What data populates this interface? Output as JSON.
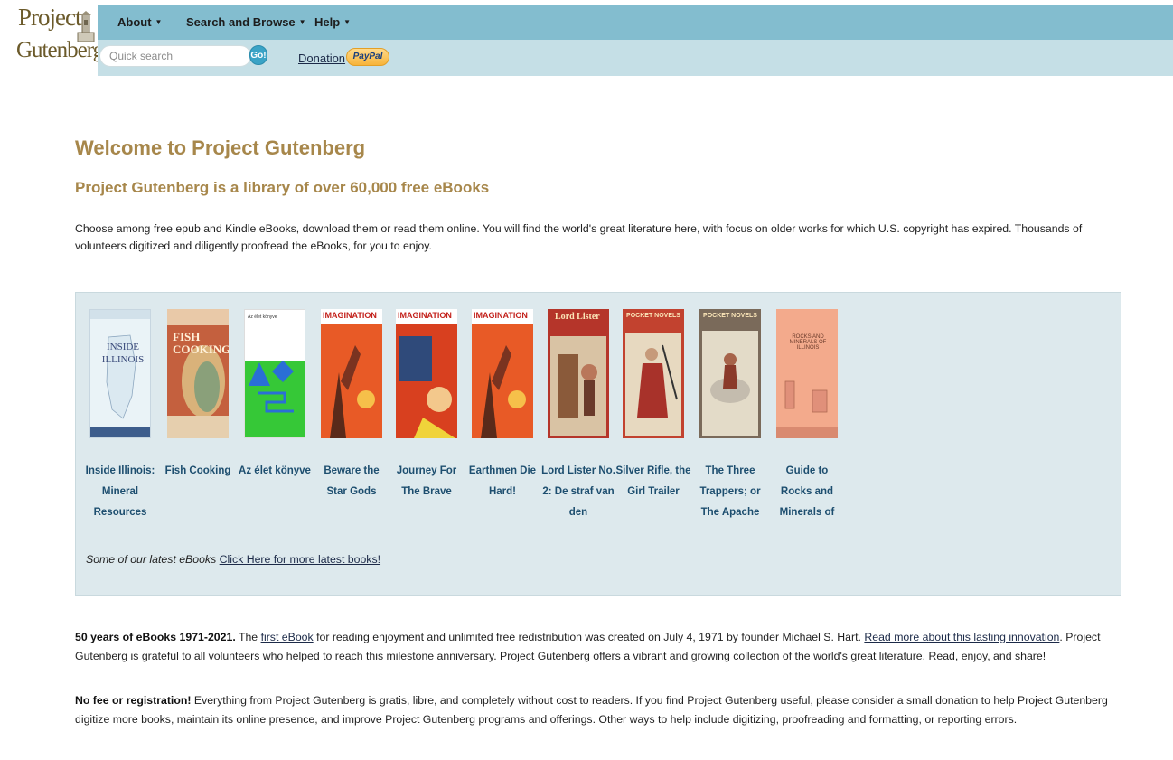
{
  "header": {
    "logo_line1": "Project",
    "logo_line2": "Gutenberg",
    "menus": [
      "About",
      "Search and Browse",
      "Help"
    ],
    "search_placeholder": "Quick search",
    "go_label": "Go!",
    "donation_label": "Donation",
    "paypal_label": "PayPal",
    "colors": {
      "top_bar": "#83bdcf",
      "bottom_bar": "#c5dfe6",
      "heading": "#a7874b"
    }
  },
  "main": {
    "title": "Welcome to Project Gutenberg",
    "subtitle": "Project Gutenberg is a library of over 60,000 free eBooks",
    "intro": "Choose among free epub and Kindle eBooks, download them or read them online. You will find the world's great literature here, with focus on older works for which U.S. copyright has expired. Thousands of volunteers digitized and diligently proofread the eBooks, for you to enjoy."
  },
  "books": [
    {
      "title": "Inside Illinois: Mineral Resources",
      "cover_text": "INSIDE ILLINOIS"
    },
    {
      "title": "Fish Cooking",
      "cover_text": "FISH COOKING"
    },
    {
      "title": "Az élet könyve",
      "cover_text": "Az élet könyve"
    },
    {
      "title": "Beware the Star Gods",
      "cover_text": "IMAGINATION"
    },
    {
      "title": "Journey For The Brave",
      "cover_text": "IMAGINATION"
    },
    {
      "title": "Earthmen Die Hard!",
      "cover_text": "IMAGINATION"
    },
    {
      "title": "Lord Lister No. 2: De straf van den",
      "cover_text": "Lord Lister"
    },
    {
      "title": "Silver Rifle, the Girl Trailer",
      "cover_text": "POCKET NOVELS"
    },
    {
      "title": "The Three Trappers; or The Apache",
      "cover_text": "POCKET NOVELS"
    },
    {
      "title": "Guide to Rocks and Minerals of",
      "cover_text": "ROCKS AND MINERALS OF ILLINOIS"
    }
  ],
  "latest": {
    "text": "Some of our latest eBooks",
    "link": "Click Here for more latest books!"
  },
  "anniversary": {
    "bold": "50 years of eBooks 1971-2021.",
    "t1": " The ",
    "link1": "first eBook",
    "t2": " for reading enjoyment and unlimited free redistribution was created on July 4, 1971 by founder Michael S. Hart. ",
    "link2": "Read more about this lasting innovation",
    "t3": ". Project Gutenberg is grateful to all volunteers who helped to reach this milestone anniversary. Project Gutenberg offers a vibrant and growing collection of the world's great literature. Read, enjoy, and share!"
  },
  "nofee": {
    "bold": "No fee or registration!",
    "text": " Everything from Project Gutenberg is gratis, libre, and completely without cost to readers. If you find Project Gutenberg useful, please consider a small donation to help Project Gutenberg digitize more books, maintain its online presence, and improve Project Gutenberg programs and offerings. Other ways to help include digitizing, proofreading and formatting, or reporting errors."
  }
}
